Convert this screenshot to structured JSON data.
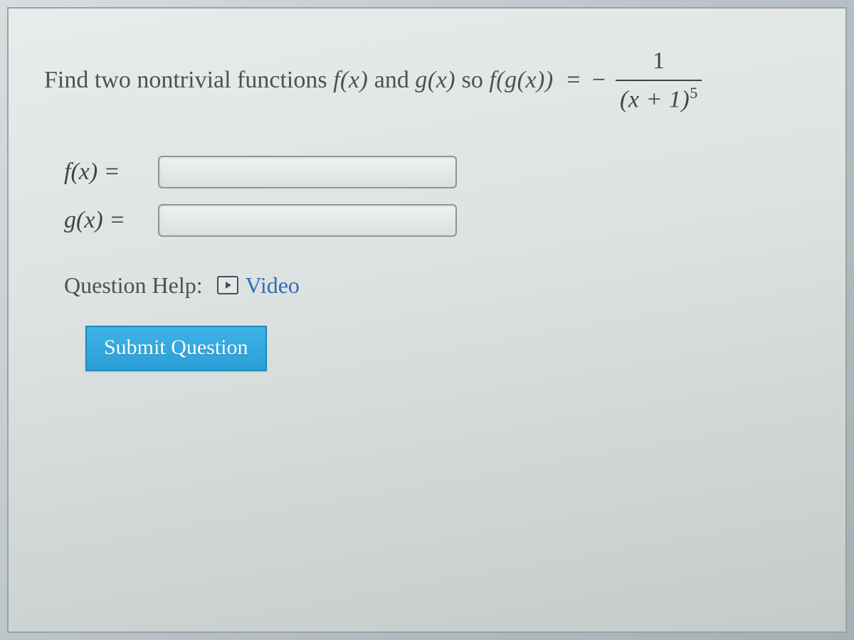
{
  "question": {
    "prompt_prefix": "Find two nontrivial functions ",
    "f_of_x": "f(x)",
    "and_word": " and ",
    "g_of_x": "g(x)",
    "so_word": " so ",
    "composition": "f(g(x))",
    "equals": " = −",
    "fraction": {
      "numerator": "1",
      "denominator_base": "(x + 1)",
      "denominator_exp": "5"
    }
  },
  "answers": {
    "f_label": "f(x) =",
    "g_label": "g(x) =",
    "f_value": "",
    "g_value": ""
  },
  "help": {
    "label": "Question Help:",
    "video_label": "Video"
  },
  "submit": {
    "label": "Submit Question"
  },
  "chart_data": {
    "type": "table",
    "title": "Function composition problem",
    "target_expression": "f(g(x)) = -1 / (x + 1)^5",
    "unknowns": [
      "f(x)",
      "g(x)"
    ]
  }
}
